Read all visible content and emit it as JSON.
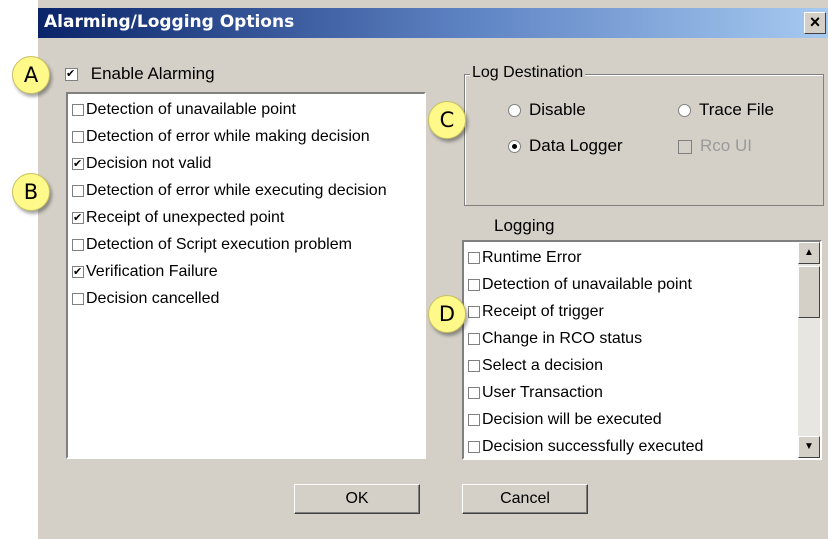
{
  "dialog": {
    "title": "Alarming/Logging Options",
    "close": "×"
  },
  "callouts": {
    "a": "A",
    "b": "B",
    "c": "C",
    "d": "D"
  },
  "enable_alarming": {
    "label": "Enable Alarming",
    "checked": true
  },
  "alarm_list": [
    {
      "label": "Detection of unavailable point",
      "checked": false
    },
    {
      "label": "Detection of error while making decision",
      "checked": false
    },
    {
      "label": "Decision not valid",
      "checked": true
    },
    {
      "label": "Detection of error while executing decision",
      "checked": false
    },
    {
      "label": "Receipt of unexpected point",
      "checked": true
    },
    {
      "label": "Detection of Script execution problem",
      "checked": false
    },
    {
      "label": "Verification Failure",
      "checked": true
    },
    {
      "label": "Decision cancelled",
      "checked": false
    }
  ],
  "log_destination": {
    "legend": "Log Destination",
    "disable": "Disable",
    "trace_file": "Trace File",
    "data_logger": "Data Logger",
    "rco_ui": "Rco UI",
    "selected": "Data Logger"
  },
  "logging": {
    "label": "Logging",
    "items": [
      {
        "label": "Runtime Error",
        "checked": false
      },
      {
        "label": "Detection of unavailable point",
        "checked": false
      },
      {
        "label": "Receipt of trigger",
        "checked": false
      },
      {
        "label": "Change in RCO status",
        "checked": false
      },
      {
        "label": "Select a decision",
        "checked": false
      },
      {
        "label": "User Transaction",
        "checked": false
      },
      {
        "label": "Decision will be executed",
        "checked": false
      },
      {
        "label": "Decision successfully executed",
        "checked": false
      }
    ]
  },
  "buttons": {
    "ok": "OK",
    "cancel": "Cancel"
  },
  "colors": {
    "titlebar_start": "#0a246a",
    "titlebar_end": "#a6caf0",
    "callout": "#fff98a",
    "face": "#d4d0c8"
  }
}
